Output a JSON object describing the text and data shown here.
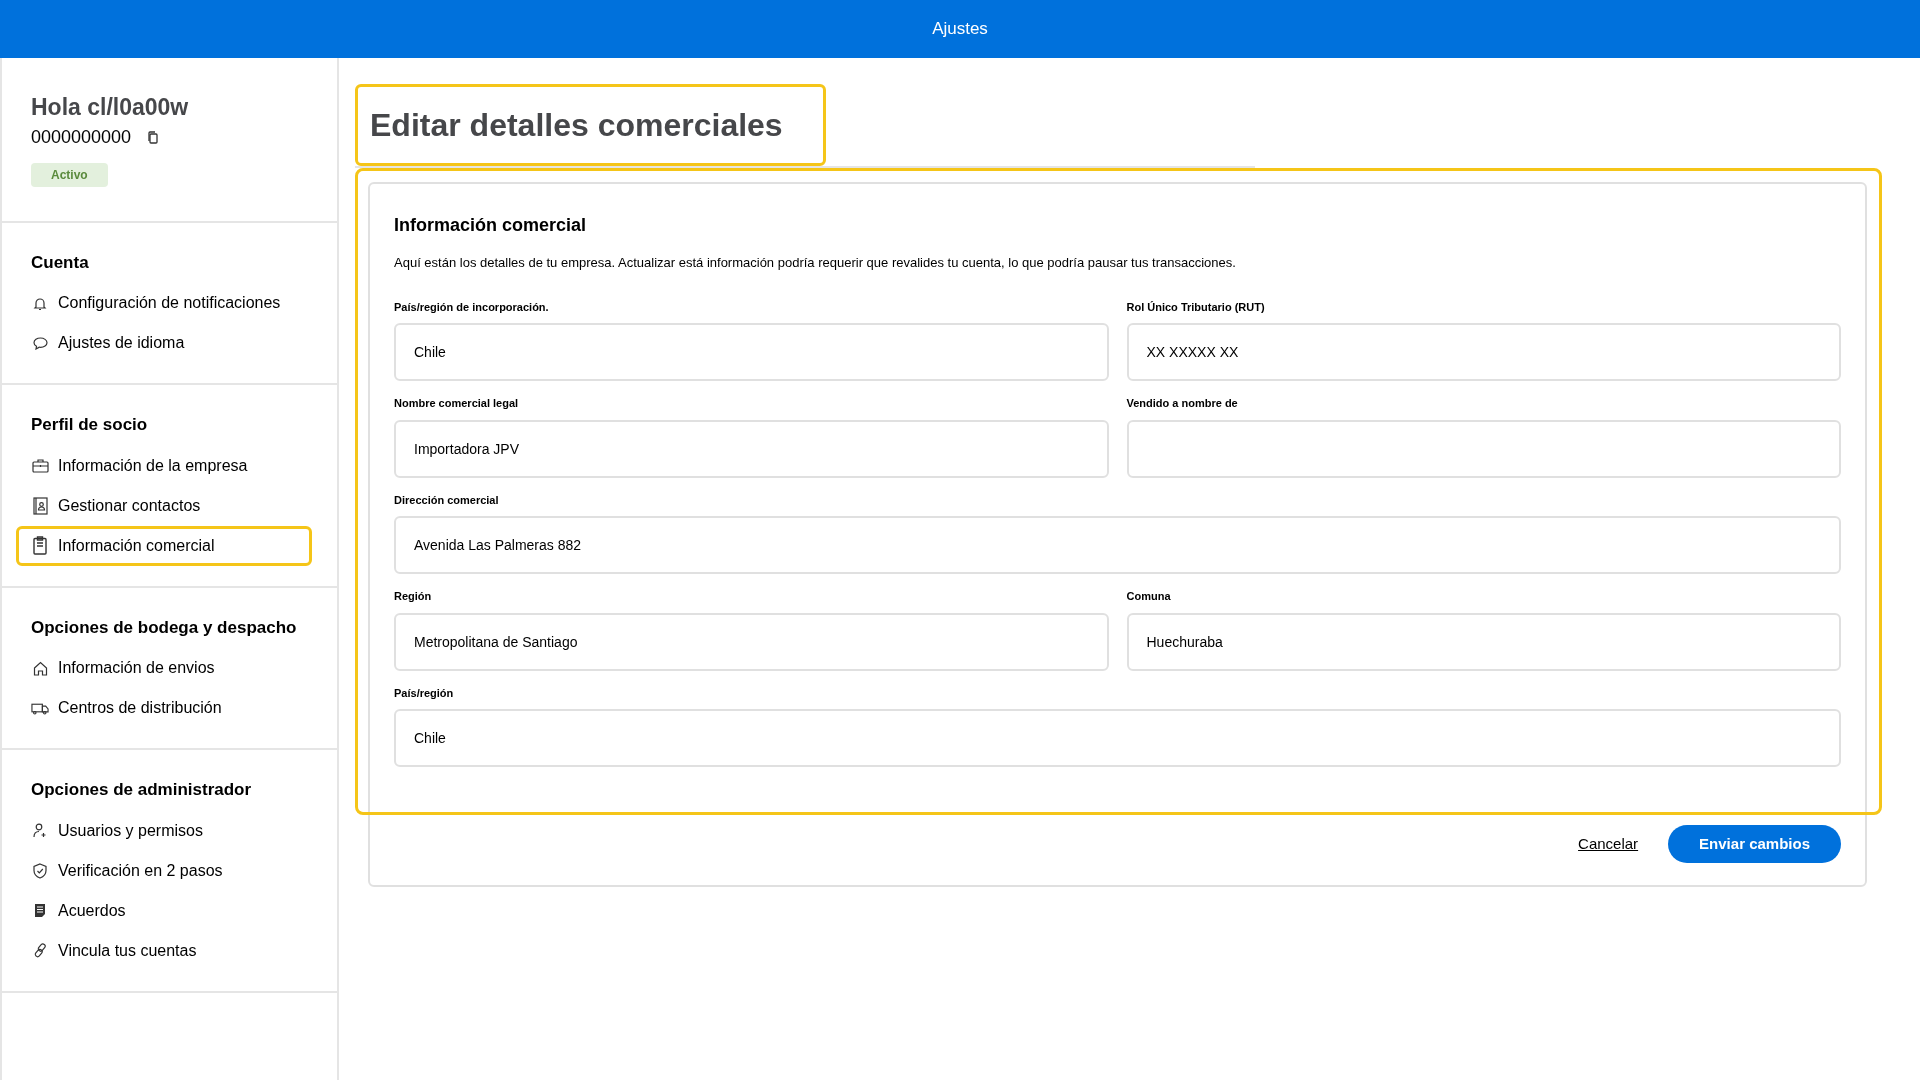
{
  "top_bar": {
    "title": "Ajustes"
  },
  "profile": {
    "greeting": "Hola cl/l0a00w",
    "account_number": "0000000000",
    "status": "Activo"
  },
  "sidebar": {
    "sections": [
      {
        "title": "Cuenta",
        "items": [
          {
            "label": "Configuración de notificaciones",
            "highlighted": false
          },
          {
            "label": "Ajustes de idioma",
            "highlighted": false
          }
        ]
      },
      {
        "title": "Perfil de socio",
        "items": [
          {
            "label": "Información de la empresa",
            "highlighted": false
          },
          {
            "label": "Gestionar contactos",
            "highlighted": false
          },
          {
            "label": "Información comercial",
            "highlighted": true
          }
        ]
      },
      {
        "title": "Opciones de bodega y despacho",
        "items": [
          {
            "label": "Información de envios",
            "highlighted": false
          },
          {
            "label": "Centros de distribución",
            "highlighted": false
          }
        ]
      },
      {
        "title": "Opciones de administrador",
        "items": [
          {
            "label": "Usuarios y permisos",
            "highlighted": false
          },
          {
            "label": "Verificación en 2 pasos",
            "highlighted": false
          },
          {
            "label": "Acuerdos",
            "highlighted": false
          },
          {
            "label": "Vincula tus cuentas",
            "highlighted": false
          }
        ]
      }
    ]
  },
  "page": {
    "title": "Editar detalles comerciales",
    "highlighted": true
  },
  "form": {
    "title": "Información comercial",
    "highlighted": true,
    "description": "Aquí están los detalles de tu empresa. Actualizar está información podría requerir que revalides tu cuenta, lo que podría pausar tus transacciones.",
    "fields": [
      {
        "kind": "half",
        "label": "País/región de incorporación.",
        "value": "Chile"
      },
      {
        "kind": "half",
        "label": "Rol Único Tributario (RUT)",
        "value": "XX XXXXX XX"
      },
      {
        "kind": "half",
        "label": "Nombre comercial legal",
        "value": "Importadora JPV"
      },
      {
        "kind": "half",
        "label": "Vendido a nombre de"
      },
      {
        "kind": "full",
        "label": "Dirección comercial",
        "value": "Avenida Las Palmeras 882"
      },
      {
        "kind": "half",
        "label": "Región",
        "value": "Metropolitana de Santiago"
      },
      {
        "kind": "half",
        "label": "Comuna",
        "value": "Huechuraba"
      },
      {
        "kind": "full",
        "label": "País/región",
        "value": "Chile"
      }
    ],
    "buttons": {
      "cancel": "Cancelar",
      "submit": "Enviar cambios"
    }
  }
}
